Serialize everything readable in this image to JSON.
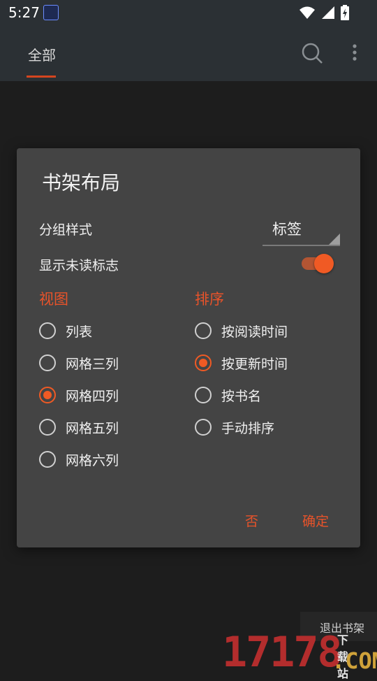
{
  "status_bar": {
    "time": "5:27"
  },
  "app_bar": {
    "tab_all": "全部"
  },
  "dialog": {
    "title": "书架布局",
    "group_style_label": "分组样式",
    "group_style_value": "标签",
    "show_unread_label": "显示未读标志",
    "show_unread_enabled": true,
    "view_heading": "视图",
    "sort_heading": "排序",
    "view_options": [
      "列表",
      "网格三列",
      "网格四列",
      "网格五列",
      "网格六列"
    ],
    "view_selected": "网格四列",
    "sort_options": [
      "按阅读时间",
      "按更新时间",
      "按书名",
      "手动排序"
    ],
    "sort_selected": "按更新时间",
    "cancel_label": "否",
    "confirm_label": "确定"
  },
  "background": {
    "exit_shelf_label": "退出书架",
    "watermark_number": "17178",
    "watermark_com": ".COM",
    "watermark_site": "下载站"
  },
  "colors": {
    "accent": "#f05a24",
    "dialog_bg": "#444444",
    "appbar_bg": "#2b3034"
  },
  "icons": [
    "search-icon",
    "more-vert-icon",
    "wifi-icon",
    "signal-icon",
    "battery-icon",
    "notification-app-icon"
  ]
}
